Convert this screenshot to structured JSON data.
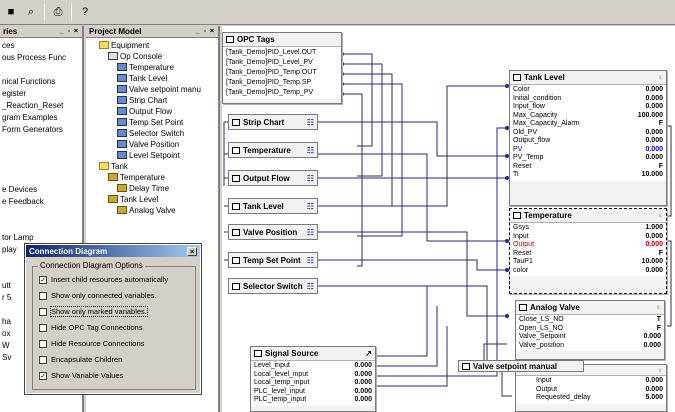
{
  "toolbar": {
    "icons": [
      "stop-icon",
      "zoom-icon",
      "print-icon",
      "help-icon"
    ]
  },
  "left_panel": {
    "header": "ries",
    "header_buttons": "_ ▫ ×",
    "items": [
      "ces",
      "ous Process Func",
      "",
      "nical Functions",
      "egister",
      "_Reaction_Reset",
      "gram Examples",
      "Form Generators",
      "",
      "",
      "",
      "",
      "e Devices",
      "e Feedback",
      "",
      "",
      "tor Lamp",
      "play",
      "",
      "",
      "utt",
      "r 5",
      "",
      "ha",
      "ox",
      "W",
      "Sv"
    ]
  },
  "project_model": {
    "header": "Project Model",
    "header_buttons": "_ ▫ ×",
    "tree": [
      {
        "label": "Equipment",
        "icon": "folder",
        "indent": 1
      },
      {
        "label": "Op Console",
        "icon": "group",
        "indent": 2
      },
      {
        "label": "Temperature",
        "icon": "node",
        "indent": 3
      },
      {
        "label": "Tank Level",
        "icon": "node",
        "indent": 3
      },
      {
        "label": "Valve setpoint manu",
        "icon": "node",
        "indent": 3
      },
      {
        "label": "Strip Chart",
        "icon": "node",
        "indent": 3
      },
      {
        "label": "Output Flow",
        "icon": "node",
        "indent": 3
      },
      {
        "label": "Temp Set Point",
        "icon": "node",
        "indent": 3
      },
      {
        "label": "Selector Switch",
        "icon": "node",
        "indent": 3
      },
      {
        "label": "Valve Position",
        "icon": "node",
        "indent": 3
      },
      {
        "label": "Level Setpoint",
        "icon": "node",
        "indent": 3
      },
      {
        "label": "Tank",
        "icon": "folder",
        "indent": 1
      },
      {
        "label": "Temperature",
        "icon": "var",
        "indent": 2
      },
      {
        "label": "Delay Time",
        "icon": "var",
        "indent": 3
      },
      {
        "label": "Tank Level",
        "icon": "var",
        "indent": 2
      },
      {
        "label": "Analog Valve",
        "icon": "var",
        "indent": 3
      }
    ]
  },
  "opc_tags": {
    "title": "OPC Tags",
    "tags": [
      "[Tank_Demo]PID_Level.OUT",
      "[Tank_Demo]PID_Level_PV",
      "[Tank_Demo]PID_Temp.OUT",
      "[Tank_Demo]PID_Temp.SP",
      "[Tank_Demo]PID_Temp_PV"
    ]
  },
  "ui_nodes": [
    "Strip Chart",
    "Temperature",
    "Output Flow",
    "Tank Level",
    "Valve Position",
    "Temp Set Point",
    "Selector Switch"
  ],
  "tank_level": {
    "title": "Tank Level",
    "rows": [
      {
        "name": "Color",
        "value": "0.000"
      },
      {
        "name": "Initial_condition",
        "value": "0.000"
      },
      {
        "name": "Input_flow",
        "value": "0.000"
      },
      {
        "name": "Max_Capacity",
        "value": "100.000"
      },
      {
        "name": "Max_Capacity_Alarm",
        "value": "F"
      },
      {
        "name": "Old_PV",
        "value": "0.000"
      },
      {
        "name": "Output_flow",
        "value": "0.000"
      },
      {
        "name": "PV",
        "value": "0.000",
        "style": "blue"
      },
      {
        "name": "PV_Temp",
        "value": "0.000"
      },
      {
        "name": "Reset",
        "value": "F"
      },
      {
        "name": "Ti",
        "value": "10.000"
      }
    ]
  },
  "temperature": {
    "title": "Temperature",
    "rows": [
      {
        "name": "Gsys",
        "value": "1.000"
      },
      {
        "name": "Input",
        "value": "0.000"
      },
      {
        "name": "Output",
        "value": "0.000",
        "style": "red"
      },
      {
        "name": "Reset",
        "value": "F"
      },
      {
        "name": "TauP1",
        "value": "10.000"
      },
      {
        "name": "color",
        "value": "0.000"
      }
    ]
  },
  "analog_valve": {
    "title": "Analog Valve",
    "rows": [
      {
        "name": "Close_LS_NO",
        "value": "T"
      },
      {
        "name": "Open_LS_NO",
        "value": "F"
      },
      {
        "name": "Valve_Setpoint",
        "value": "0.000"
      },
      {
        "name": "Valve_position",
        "value": "0.000"
      }
    ]
  },
  "delay_block": {
    "rows": [
      {
        "name": "Input",
        "value": "0.000"
      },
      {
        "name": "Output",
        "value": "0.000"
      },
      {
        "name": "Requested_delay",
        "value": "5.000"
      }
    ]
  },
  "signal_source": {
    "title": "Signal Source",
    "rows": [
      {
        "name": "Level_input",
        "value": "0.000"
      },
      {
        "name": "Local_level_input",
        "value": "0.000"
      },
      {
        "name": "Local_temp_input",
        "value": "0.000"
      },
      {
        "name": "PLC_level_input",
        "value": "0.000"
      },
      {
        "name": "PLC_temp_input",
        "value": "0.000"
      }
    ]
  },
  "valve_manual": {
    "title": "Valve setpoint manual"
  },
  "dialog": {
    "title": "Connection Diagram",
    "close": "×",
    "group_label": "Connection Diagram Options",
    "options": [
      {
        "label": "Insert child resources automatically",
        "checked": true
      },
      {
        "label": "Show only connected variables.",
        "checked": false
      },
      {
        "label": "Show only marked variables.",
        "checked": false,
        "focused": true
      },
      {
        "label": "Hide OPC Tag Connections",
        "checked": false
      },
      {
        "label": "Hide Resource Connections",
        "checked": false
      },
      {
        "label": "Encapsulate Children",
        "checked": false
      },
      {
        "label": "Show Variable Values",
        "checked": true
      }
    ]
  }
}
